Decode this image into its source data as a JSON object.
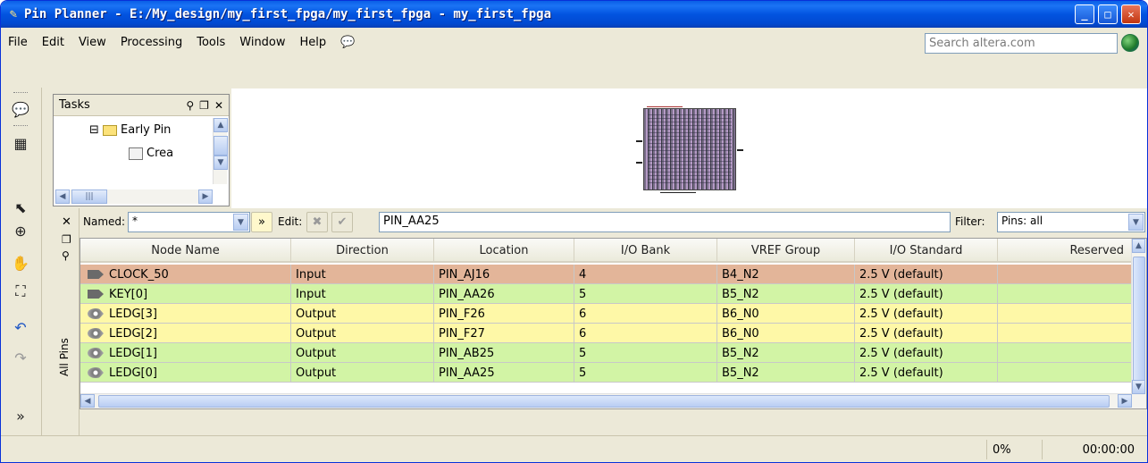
{
  "window": {
    "title": "Pin Planner - E:/My_design/my_first_fpga/my_first_fpga - my_first_fpga"
  },
  "menu": {
    "items": [
      "File",
      "Edit",
      "View",
      "Processing",
      "Tools",
      "Window",
      "Help"
    ],
    "search_placeholder": "Search altera.com"
  },
  "tasks": {
    "title": "Tasks",
    "tree": [
      {
        "label": "Early Pin"
      },
      {
        "label": "Crea"
      }
    ]
  },
  "filter": {
    "named_label": "Named:",
    "named_value": "*",
    "edit_label": "Edit:",
    "edit_value": "PIN_AA25",
    "filter_label": "Filter:",
    "filter_value": "Pins: all"
  },
  "side_tab": "All Pins",
  "table": {
    "columns": [
      "Node Name",
      "Direction",
      "Location",
      "I/O Bank",
      "VREF Group",
      "I/O Standard",
      "Reserved"
    ],
    "rows": [
      {
        "name": "CLOCK_50",
        "direction": "Input",
        "location": "PIN_AJ16",
        "bank": "4",
        "vref": "B4_N2",
        "standard": "2.5 V (default)",
        "reserved": "",
        "color": "#e3b599",
        "type": "in"
      },
      {
        "name": "KEY[0]",
        "direction": "Input",
        "location": "PIN_AA26",
        "bank": "5",
        "vref": "B5_N2",
        "standard": "2.5 V (default)",
        "reserved": "",
        "color": "#d2f4a5",
        "type": "in"
      },
      {
        "name": "LEDG[3]",
        "direction": "Output",
        "location": "PIN_F26",
        "bank": "6",
        "vref": "B6_N0",
        "standard": "2.5 V (default)",
        "reserved": "",
        "color": "#fef8a7",
        "type": "out"
      },
      {
        "name": "LEDG[2]",
        "direction": "Output",
        "location": "PIN_F27",
        "bank": "6",
        "vref": "B6_N0",
        "standard": "2.5 V (default)",
        "reserved": "",
        "color": "#fef8a7",
        "type": "out"
      },
      {
        "name": "LEDG[1]",
        "direction": "Output",
        "location": "PIN_AB25",
        "bank": "5",
        "vref": "B5_N2",
        "standard": "2.5 V (default)",
        "reserved": "",
        "color": "#d2f4a5",
        "type": "out"
      },
      {
        "name": "LEDG[0]",
        "direction": "Output",
        "location": "PIN_AA25",
        "bank": "5",
        "vref": "B5_N2",
        "standard": "2.5 V (default)",
        "reserved": "",
        "color": "#d2f4a5",
        "type": "out"
      }
    ]
  },
  "status": {
    "progress": "0%",
    "time": "00:00:00"
  }
}
